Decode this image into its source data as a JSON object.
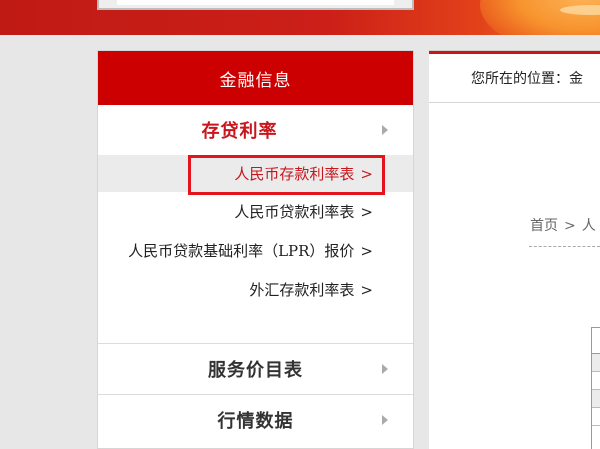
{
  "banner": {},
  "sidebar": {
    "header": "金融信息",
    "active_section": {
      "label": "存贷利率"
    },
    "sub_items": [
      {
        "label": "人民币存款利率表",
        "suffix": ">"
      },
      {
        "label": "人民币贷款利率表",
        "suffix": ">"
      },
      {
        "label": "人民币贷款基础利率（LPR）报价",
        "suffix": ">"
      },
      {
        "label": "外汇存款利率表",
        "suffix": ">"
      }
    ],
    "sections": [
      {
        "label": "服务价目表"
      },
      {
        "label": "行情数据"
      }
    ]
  },
  "main": {
    "location_label": "您所在的位置：金",
    "breadcrumb": {
      "home": "首页",
      "separator": ">",
      "next": "人"
    }
  }
}
